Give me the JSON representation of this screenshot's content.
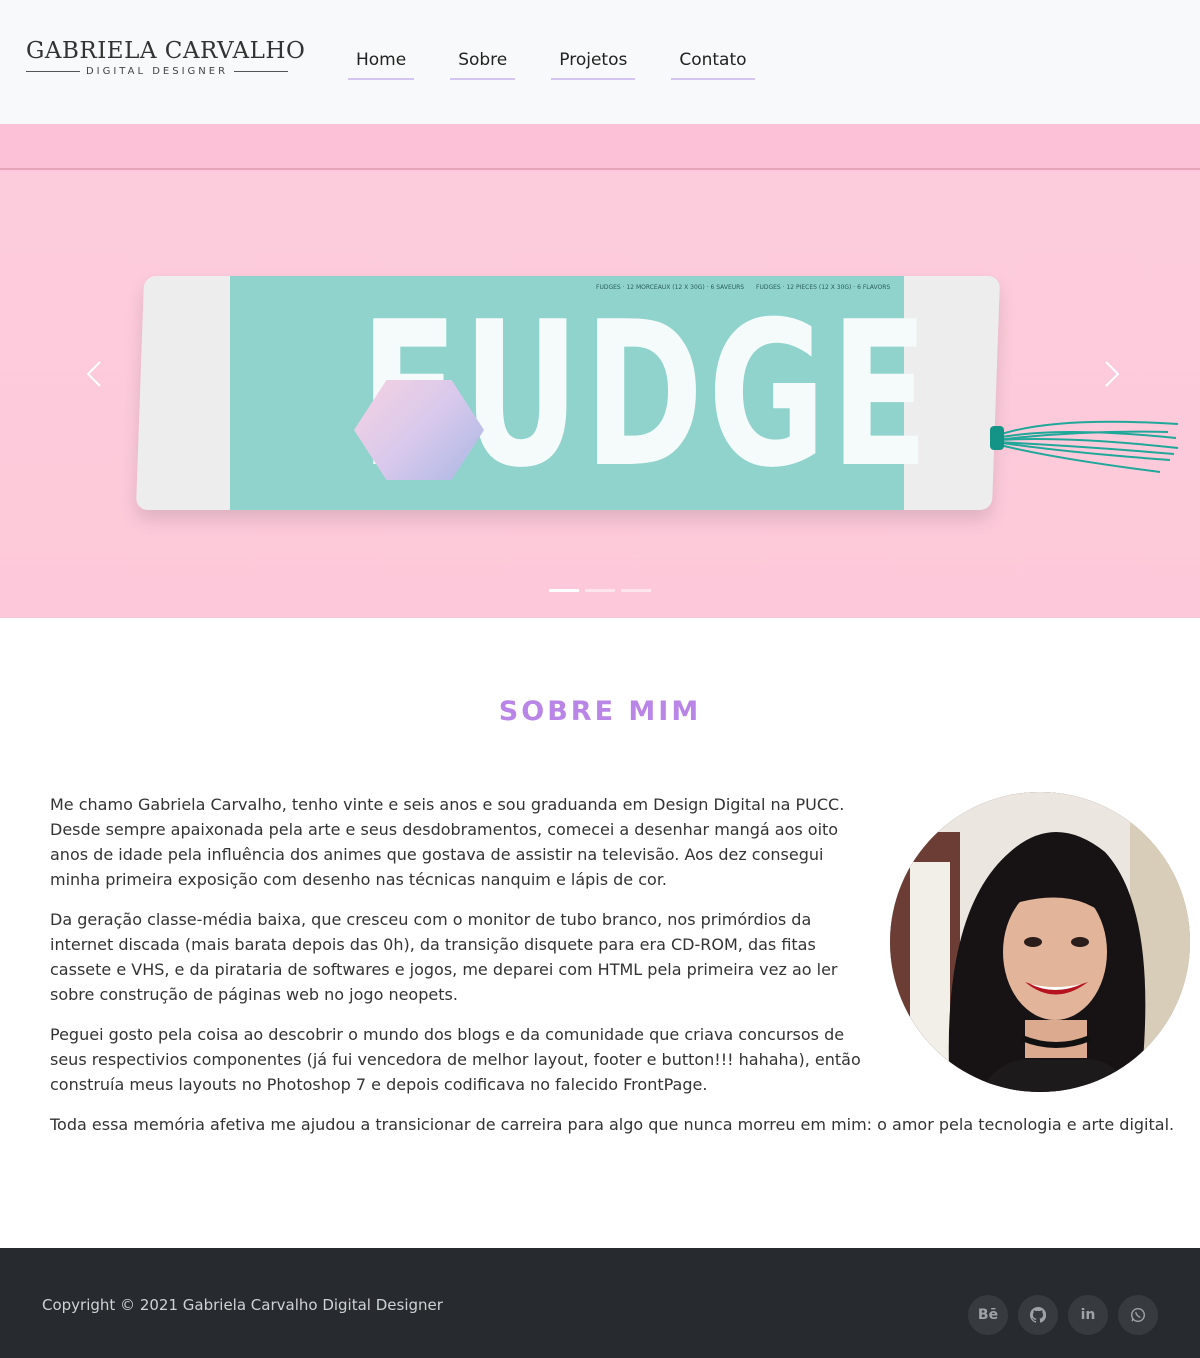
{
  "header": {
    "logo_name": "GABRIELA CARVALHO",
    "logo_subtitle": "DIGITAL DESIGNER",
    "nav": [
      {
        "label": "Home"
      },
      {
        "label": "Sobre"
      },
      {
        "label": "Projetos"
      },
      {
        "label": "Contato"
      }
    ]
  },
  "hero": {
    "product_text": "FUDGE",
    "sleeve_info_left": "FUDGES · 12 MORCEAUX (12 X 30G) · 6 SAVEURS",
    "sleeve_info_right": "FUDGES · 12 PIECES (12 X 30G) · 6 FLAVORS",
    "slide_count": 3,
    "active_slide": 1
  },
  "about": {
    "title": "SOBRE MIM",
    "paragraphs": [
      "Me chamo Gabriela Carvalho, tenho vinte e seis anos e sou graduanda em Design Digital na PUCC. Desde sempre apaixonada pela arte e seus desdobramentos, comecei a desenhar mangá aos oito anos de idade pela influência dos animes que gostava de assistir na televisão. Aos dez consegui minha primeira exposição com desenho nas técnicas nanquim e lápis de cor.",
      "Da geração classe-média baixa, que cresceu com o monitor de tubo branco, nos primórdios da internet discada (mais barata depois das 0h), da transição disquete para era CD-ROM, das fitas cassete e VHS, e da pirataria de softwares e jogos, me deparei com HTML pela primeira vez ao ler sobre construção de páginas web no jogo neopets.",
      "Peguei gosto pela coisa ao descobrir o mundo dos blogs e da comunidade que criava concursos de seus respectivios componentes (já fui vencedora de melhor layout, footer e button!!! hahaha), então construía meus layouts no Photoshop 7 e depois codificava no falecido FrontPage.",
      "Toda essa memória afetiva me ajudou a transicionar de carreira para algo que nunca morreu em mim: o amor pela tecnologia e arte digital."
    ]
  },
  "footer": {
    "copyright": "Copyright © 2021 Gabriela Carvalho Digital Designer",
    "social": [
      {
        "icon": "behance-icon",
        "glyph": "Bē"
      },
      {
        "icon": "github-icon",
        "glyph": ""
      },
      {
        "icon": "linkedin-icon",
        "glyph": "in"
      },
      {
        "icon": "whatsapp-icon",
        "glyph": ""
      }
    ]
  },
  "colors": {
    "accent": "#b985e6",
    "nav_underline": "#d4c6f0",
    "hero_bg": "#fdc7dd",
    "footer_bg": "#272a2e"
  }
}
